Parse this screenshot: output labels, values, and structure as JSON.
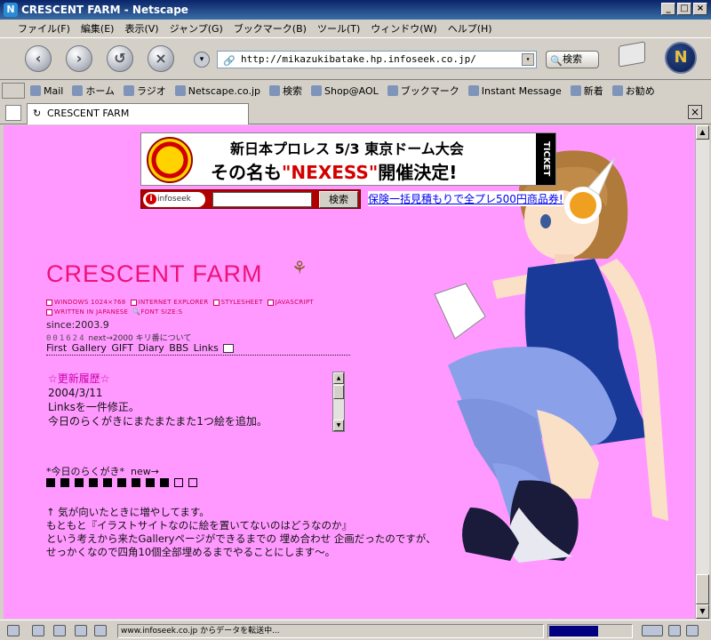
{
  "window": {
    "title": "CRESCENT FARM - Netscape",
    "app_icon": "N"
  },
  "menu": [
    "ファイル(F)",
    "編集(E)",
    "表示(V)",
    "ジャンプ(G)",
    "ブックマーク(B)",
    "ツール(T)",
    "ウィンドウ(W)",
    "ヘルプ(H)"
  ],
  "nav": {
    "url": "http://mikazukibatake.hp.infoseek.co.jp/",
    "search_label": "検索"
  },
  "personal_toolbar": [
    "Mail",
    "ホーム",
    "ラジオ",
    "Netscape.co.jp",
    "検索",
    "Shop@AOL",
    "ブックマーク",
    "Instant Message",
    "新着",
    "お勧め"
  ],
  "tab": {
    "title": "CRESCENT FARM"
  },
  "banner": {
    "line1": "新日本プロレス 5/3 東京ドーム大会",
    "line2_pre": "その名も",
    "line2_em": "\"NEXESS\"",
    "line2_post": "開催決定!",
    "ticket": "TICKET"
  },
  "infoseek": {
    "logo": "infoseek",
    "button": "検索",
    "ad_link": "保険一括見積もりで全プレ500円商品券!"
  },
  "site": {
    "title": "CRESCENT FARM",
    "specs1": [
      "WINDOWS 1024×768",
      "INTERNET EXPLORER",
      "STYLESHEET",
      "JAVASCRIPT"
    ],
    "specs2": [
      "WRITTEN IN JAPANESE",
      "FONT SIZE:S"
    ],
    "since": "since:2003.9",
    "counter": "001624",
    "kiriban": "next→2000 キリ番について",
    "links": "First Gallery GIFT Diary BBS Links"
  },
  "update": {
    "heading": "☆更新履歴☆",
    "date": "2004/3/11",
    "line1": "Linksを一件修正。",
    "line2": "今日のらくがきにまたまたまた1つ絵を追加。"
  },
  "rakugaki": {
    "label": "*今日のらくがき*",
    "new": "new→",
    "filled": 9,
    "empty": 2
  },
  "body": {
    "line1": "↑ 気が向いたときに増やしてます。",
    "line2": "もともと『イラストサイトなのに絵を置いてないのはどうなのか』",
    "line3": "という考えから来たGalleryページができるまでの 埋め合わせ 企画だったのですが、",
    "line4": "せっかくなので四角10個全部埋めるまでやることにします〜。"
  },
  "status": {
    "text": "www.infoseek.co.jp からデータを転送中...",
    "progress": 0.6
  },
  "colors": {
    "page_bg": "#ff99ff",
    "title_pink": "#ee1177",
    "chrome": "#d4d0c8"
  }
}
